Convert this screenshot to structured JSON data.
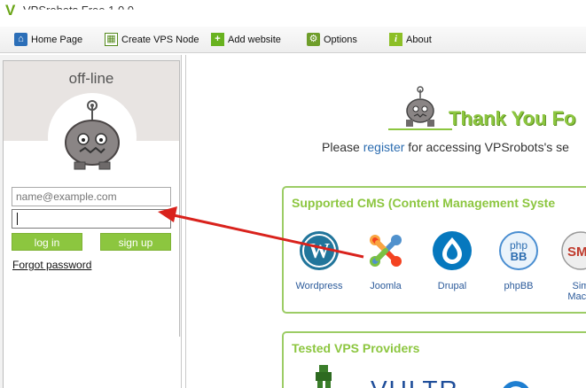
{
  "window": {
    "title": "VPSrobots Free 1.0.0"
  },
  "toolbar": {
    "items": [
      {
        "label": "Home Page",
        "icon": "home-icon"
      },
      {
        "label": "Create VPS Node",
        "icon": "create-node-icon"
      },
      {
        "label": "Add website",
        "icon": "add-icon"
      },
      {
        "label": "Options",
        "icon": "gear-icon"
      },
      {
        "label": "About",
        "icon": "info-icon"
      }
    ]
  },
  "login": {
    "status": "off-line",
    "email_placeholder": "name@example.com",
    "password_value": "",
    "login_label": "log in",
    "signup_label": "sign up",
    "forgot_label": "Forgot password"
  },
  "main": {
    "thank_title": "Thank You Fo",
    "please_prefix": "Please ",
    "register_link": "register",
    "please_suffix": " for accessing VPSrobots's se",
    "cms": {
      "title": "Supported CMS (Content Management Syste",
      "items": [
        {
          "label": "Wordpress",
          "icon": "wordpress-icon"
        },
        {
          "label": "Joomla",
          "icon": "joomla-icon"
        },
        {
          "label": "Drupal",
          "icon": "drupal-icon"
        },
        {
          "label": "phpBB",
          "icon": "phpbb-icon"
        },
        {
          "label": "Sim",
          "label2": "Machi",
          "icon": "smf-icon"
        }
      ]
    },
    "vps": {
      "title": "Tested VPS Providers",
      "provider_text": "VULTR"
    }
  },
  "colors": {
    "accent_green": "#8cc63f",
    "link_blue": "#2b6cb0",
    "arrow_red": "#d9221c"
  }
}
